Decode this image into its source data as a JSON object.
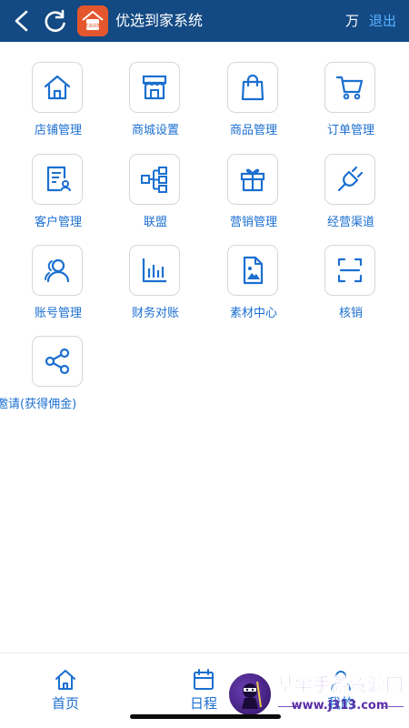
{
  "header": {
    "title": "优选到家系统",
    "logo_text": "优选到家",
    "user_name": "万",
    "logout_label": "退出",
    "background_color": "#134a84",
    "logout_color": "#5ab0ff"
  },
  "menu": {
    "accent_color": "#1b6fd0",
    "items": [
      {
        "label": "店铺管理",
        "icon": "home-icon"
      },
      {
        "label": "商城设置",
        "icon": "storefront-icon"
      },
      {
        "label": "商品管理",
        "icon": "shopping-bag-icon"
      },
      {
        "label": "订单管理",
        "icon": "cart-icon"
      },
      {
        "label": "客户管理",
        "icon": "customer-doc-icon"
      },
      {
        "label": "联盟",
        "icon": "alliance-network-icon"
      },
      {
        "label": "营销管理",
        "icon": "gift-icon"
      },
      {
        "label": "经营渠道",
        "icon": "plug-icon"
      },
      {
        "label": "账号管理",
        "icon": "users-icon"
      },
      {
        "label": "财务对账",
        "icon": "bar-chart-icon"
      },
      {
        "label": "素材中心",
        "icon": "image-file-icon"
      },
      {
        "label": "核销",
        "icon": "scan-icon"
      },
      {
        "label": "邀请(获得佣金)",
        "icon": "share-icon"
      }
    ]
  },
  "bottom_nav": {
    "items": [
      {
        "label": "首页",
        "icon": "home-outline-icon"
      },
      {
        "label": "日程",
        "icon": "calendar-icon"
      },
      {
        "label": "我的",
        "icon": "user-icon"
      }
    ]
  },
  "watermark": {
    "title": "基伞手游资源网",
    "url": "www.j313.com"
  }
}
